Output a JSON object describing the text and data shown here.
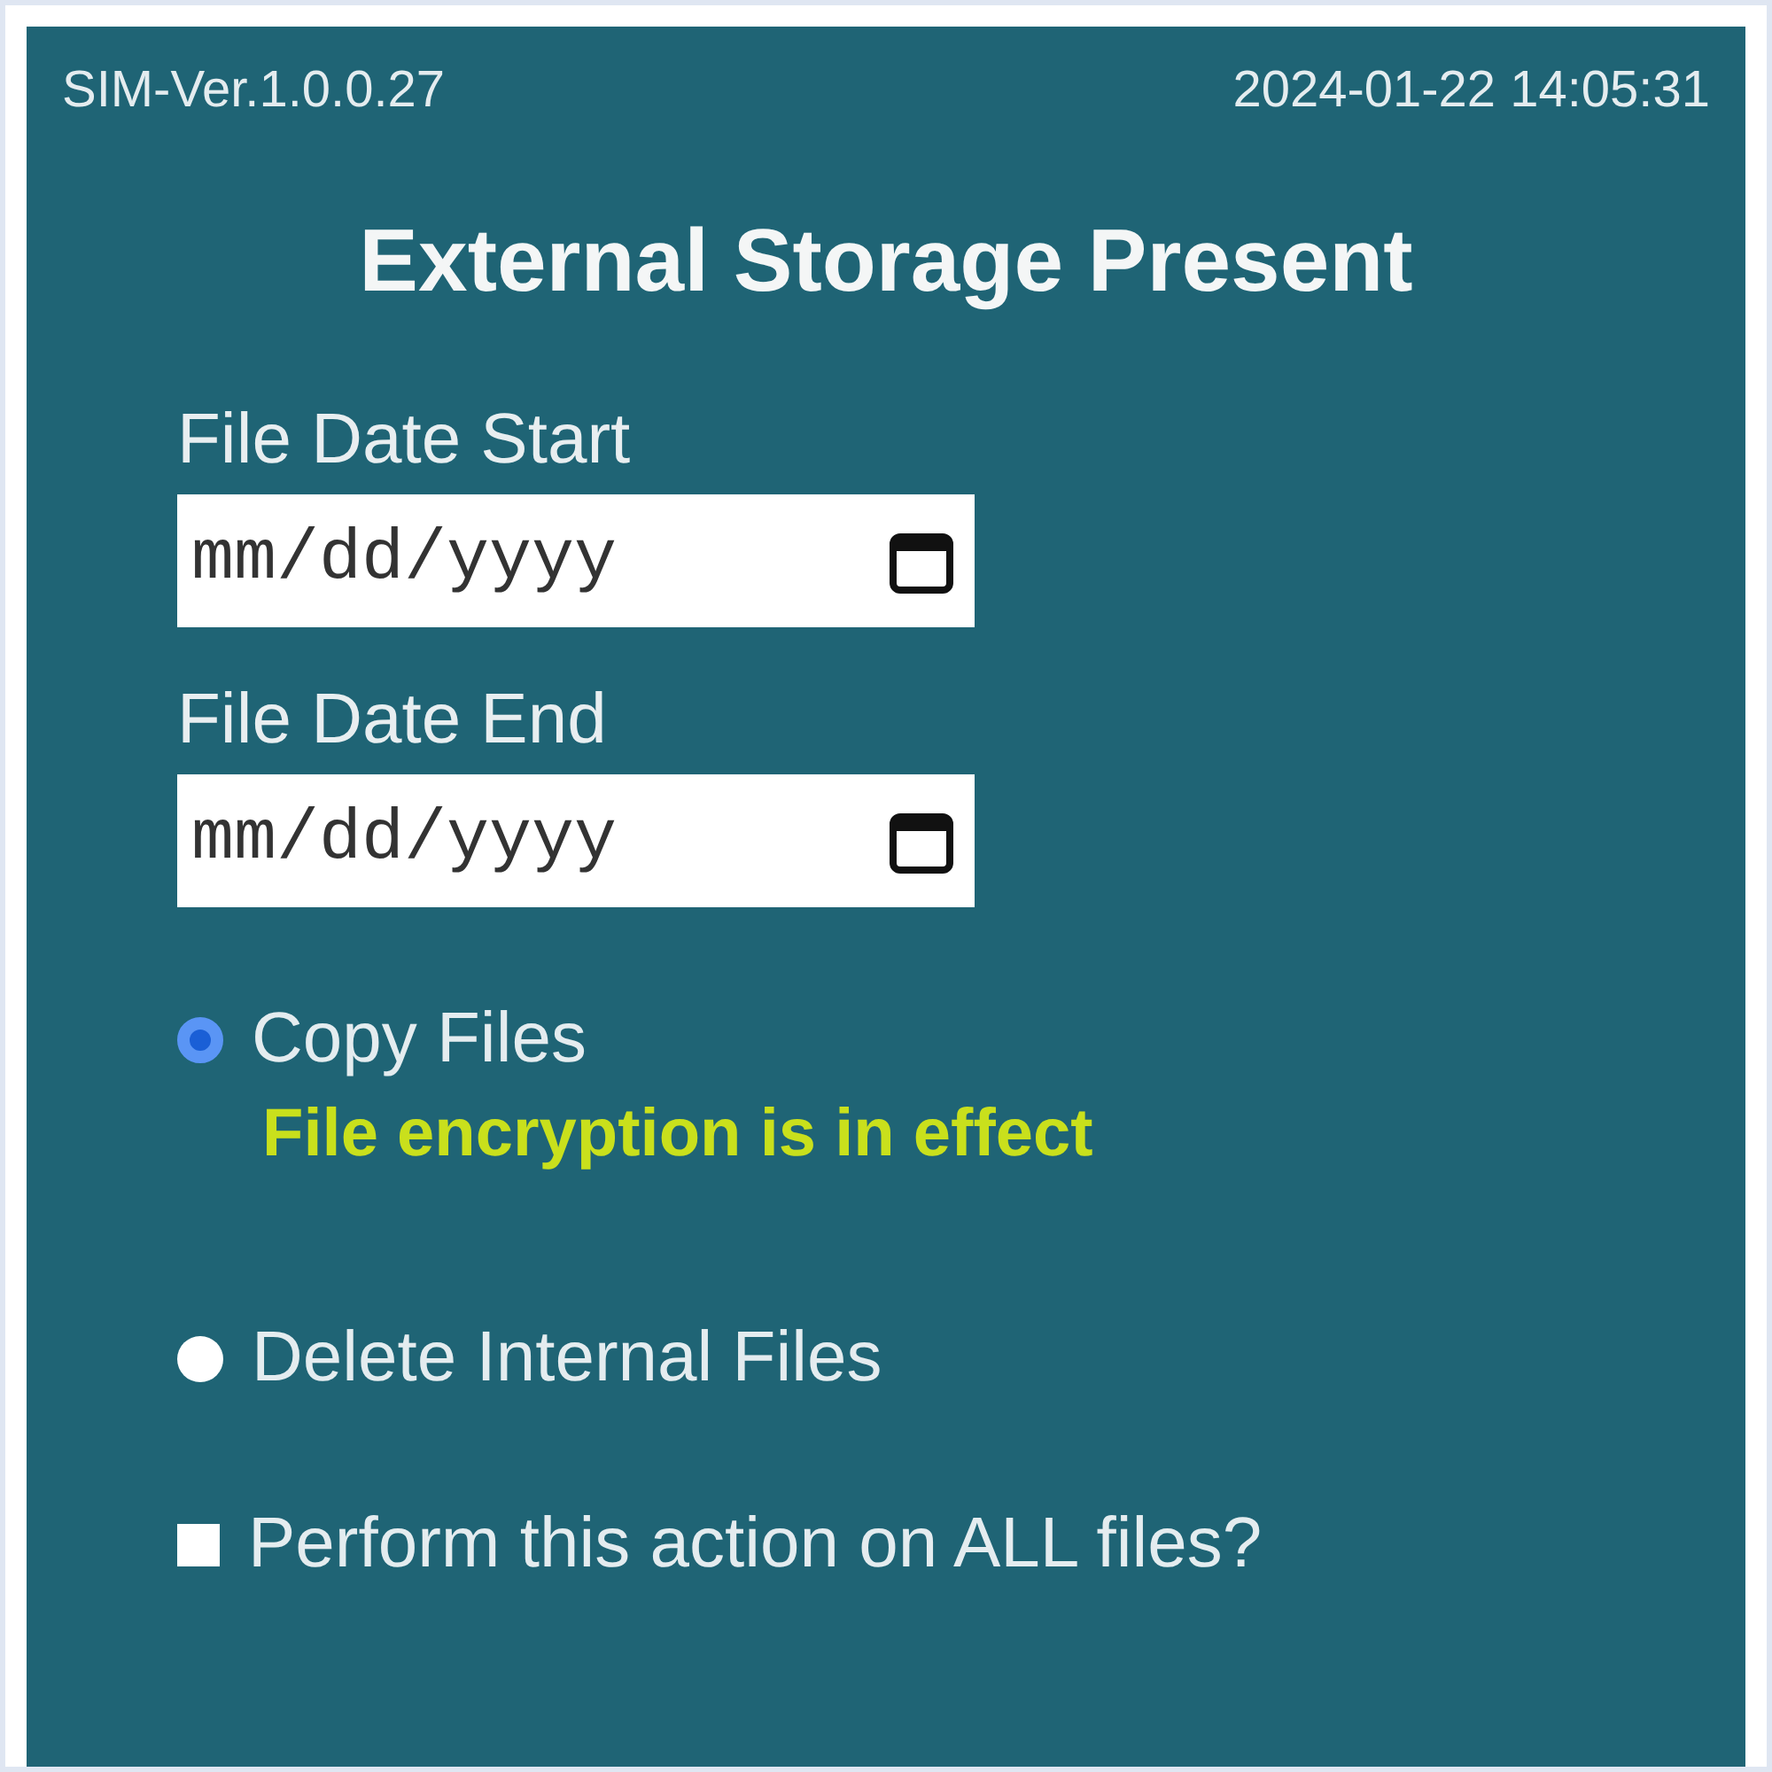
{
  "header": {
    "version": "SIM-Ver.1.0.0.27",
    "timestamp": "2024-01-22 14:05:31"
  },
  "title": "External Storage Present",
  "date_fields": [
    {
      "label": "File Date Start",
      "placeholder": "mm/dd/yyyy"
    },
    {
      "label": "File Date End",
      "placeholder": "mm/dd/yyyy"
    }
  ],
  "actions": [
    {
      "label": "Copy Files",
      "selected": true,
      "note": "File encryption is in effect"
    },
    {
      "label": "Delete Internal Files",
      "selected": false
    }
  ],
  "all_files": {
    "label": "Perform this action on ALL files?",
    "checked": false
  }
}
